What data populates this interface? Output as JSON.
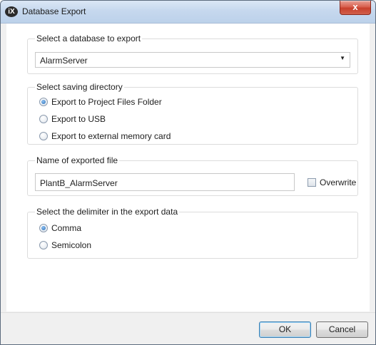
{
  "window": {
    "title": "Database Export",
    "app_icon": "iX",
    "close_glyph": "x"
  },
  "database_group": {
    "label": "Select a database to export",
    "selected": "AlarmServer",
    "arrow": "▼"
  },
  "directory_group": {
    "label": "Select saving directory",
    "options": [
      {
        "label": "Export to Project Files Folder",
        "checked": true
      },
      {
        "label": "Export to USB",
        "checked": false
      },
      {
        "label": "Export to external memory card",
        "checked": false
      }
    ]
  },
  "filename_group": {
    "label": "Name of exported file",
    "value": "PlantB_AlarmServer",
    "overwrite_label": "Overwrite",
    "overwrite_checked": false
  },
  "delimiter_group": {
    "label": "Select the delimiter in the export data",
    "options": [
      {
        "label": "Comma",
        "checked": true
      },
      {
        "label": "Semicolon",
        "checked": false
      }
    ]
  },
  "buttons": {
    "ok": "OK",
    "cancel": "Cancel"
  },
  "colors": {
    "accent": "#2a6fb8",
    "close": "#c8402c",
    "titlebar": "#c6d8ee"
  }
}
